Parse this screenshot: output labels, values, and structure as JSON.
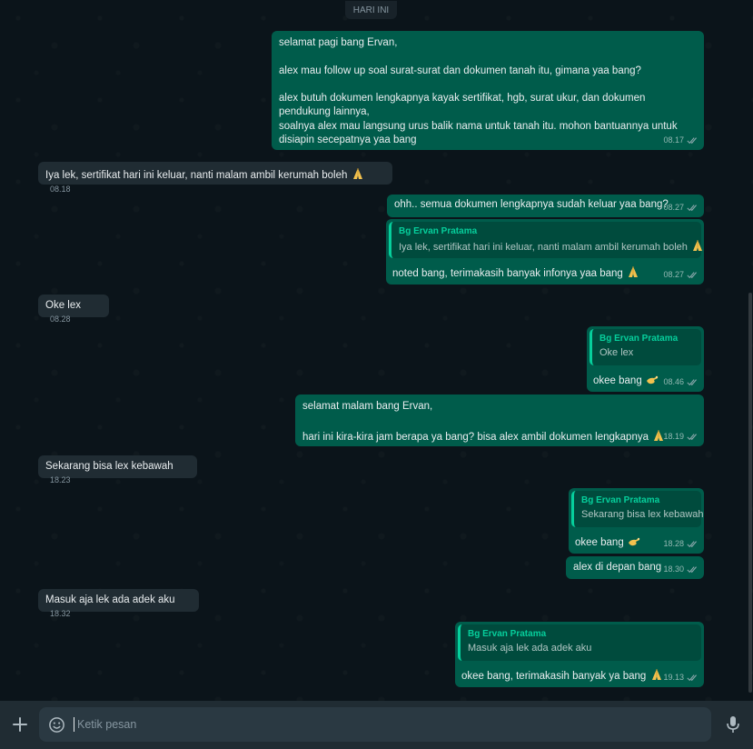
{
  "date_chip": "HARI INI",
  "messages": [
    {
      "text": "selamat pagi bang Ervan,\n\nalex mau follow up soal surat-surat dan dokumen tanah itu, gimana yaa bang?\n\nalex butuh dokumen lengkapnya kayak sertifikat, hgb, surat ukur, dan dokumen pendukung lainnya,\nsoalnya alex mau langsung urus balik nama untuk tanah itu. mohon bantuannya untuk disiapin secepatnya yaa bang",
      "time": "08.17"
    },
    {
      "text": "Iya lek, sertifikat hari ini keluar, nanti malam ambil kerumah boleh",
      "time": "08.18"
    },
    {
      "text": "ohh.. semua dokumen lengkapnya sudah keluar yaa bang?",
      "time": "08.27"
    },
    {
      "quote_author": "Bg Ervan Pratama",
      "quote_text": "Iya lek, sertifikat hari ini keluar, nanti malam ambil kerumah boleh",
      "text": "noted bang, terimakasih banyak infonya yaa bang",
      "time": "08.27"
    },
    {
      "text": "Oke lex",
      "time": "08.28"
    },
    {
      "quote_author": "Bg Ervan Pratama",
      "quote_text": "Oke lex",
      "text": "okee bang",
      "time": "08.46"
    },
    {
      "text": "selamat malam bang Ervan,\n\nhari ini kira-kira jam berapa ya bang? bisa alex ambil dokumen lengkapnya",
      "time": "18.19"
    },
    {
      "text": "Sekarang bisa lex kebawah",
      "time": "18.23"
    },
    {
      "quote_author": "Bg Ervan Pratama",
      "quote_text": "Sekarang bisa lex kebawah",
      "text": "okee bang",
      "time": "18.28"
    },
    {
      "text": "alex di depan bang",
      "time": "18.30"
    },
    {
      "text": "Masuk aja lek ada adek aku",
      "time": "18.32"
    },
    {
      "quote_author": "Bg Ervan Pratama",
      "quote_text": "Masuk aja lek ada adek aku",
      "text": "okee bang, terimakasih banyak ya bang",
      "time": "19.13"
    }
  ],
  "composer": {
    "placeholder": "Ketik pesan"
  },
  "icons": {
    "read_receipt": "double-check-icon",
    "pray": "folded-hands-emoji",
    "pinch": "pinching-hand-emoji",
    "attach": "plus-icon",
    "emoji": "smiley-icon",
    "voice": "microphone-icon"
  },
  "colors": {
    "background": "#0b141a",
    "incoming_bubble": "#202c33",
    "outgoing_bubble": "#005c4b",
    "quote_accent": "#06cf9c",
    "composer_bar": "#202c33"
  }
}
